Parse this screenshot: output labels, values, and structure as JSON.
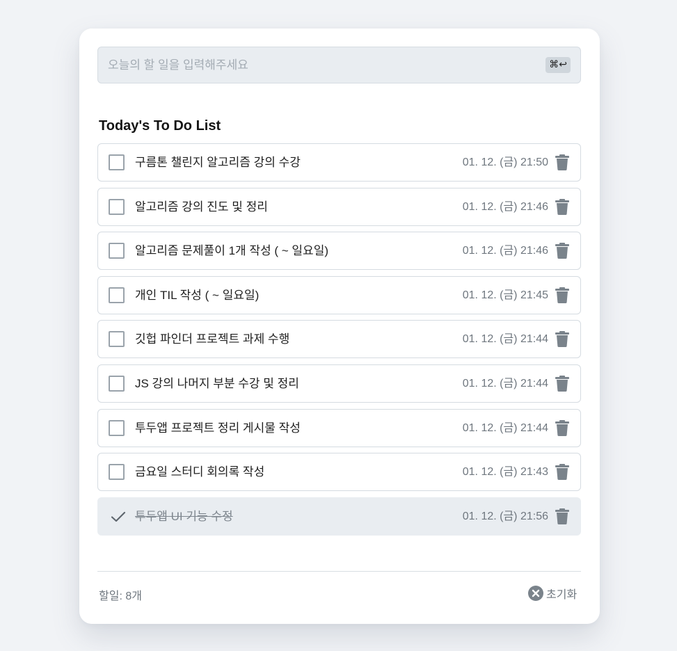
{
  "input": {
    "placeholder": "오늘의 할 일을 입력해주세요",
    "value": "",
    "shortcut": "⌘↩"
  },
  "list": {
    "title": "Today's To Do List",
    "items": [
      {
        "text": "구름톤 챌린지 알고리즘 강의 수강",
        "date": "01. 12. (금) 21:50",
        "done": false
      },
      {
        "text": "알고리즘 강의 진도 및 정리",
        "date": "01. 12. (금) 21:46",
        "done": false
      },
      {
        "text": "알고리즘 문제풀이 1개 작성 ( ~ 일요일)",
        "date": "01. 12. (금) 21:46",
        "done": false
      },
      {
        "text": "개인 TIL 작성 ( ~ 일요일)",
        "date": "01. 12. (금) 21:45",
        "done": false
      },
      {
        "text": "깃헙 파인더 프로젝트 과제 수행",
        "date": "01. 12. (금) 21:44",
        "done": false
      },
      {
        "text": "JS 강의 나머지 부분 수강 및 정리",
        "date": "01. 12. (금) 21:44",
        "done": false
      },
      {
        "text": "투두앱 프로젝트 정리 게시물 작성",
        "date": "01. 12. (금) 21:44",
        "done": false
      },
      {
        "text": "금요일 스터디 회의록 작성",
        "date": "01. 12. (금) 21:43",
        "done": false
      },
      {
        "text": "투두앱 UI 기능 수정",
        "date": "01. 12. (금) 21:56",
        "done": true
      }
    ]
  },
  "footer": {
    "count_label": "할일: 8개",
    "reset_label": "초기화"
  },
  "icons": {
    "trash": "trash-icon",
    "check": "check-icon",
    "reset": "close-circle-icon"
  },
  "colors": {
    "background": "#f1f3f6",
    "card": "#ffffff",
    "done_row": "#e9edf1",
    "muted_text": "#6f777f",
    "icon": "#7a838b"
  }
}
